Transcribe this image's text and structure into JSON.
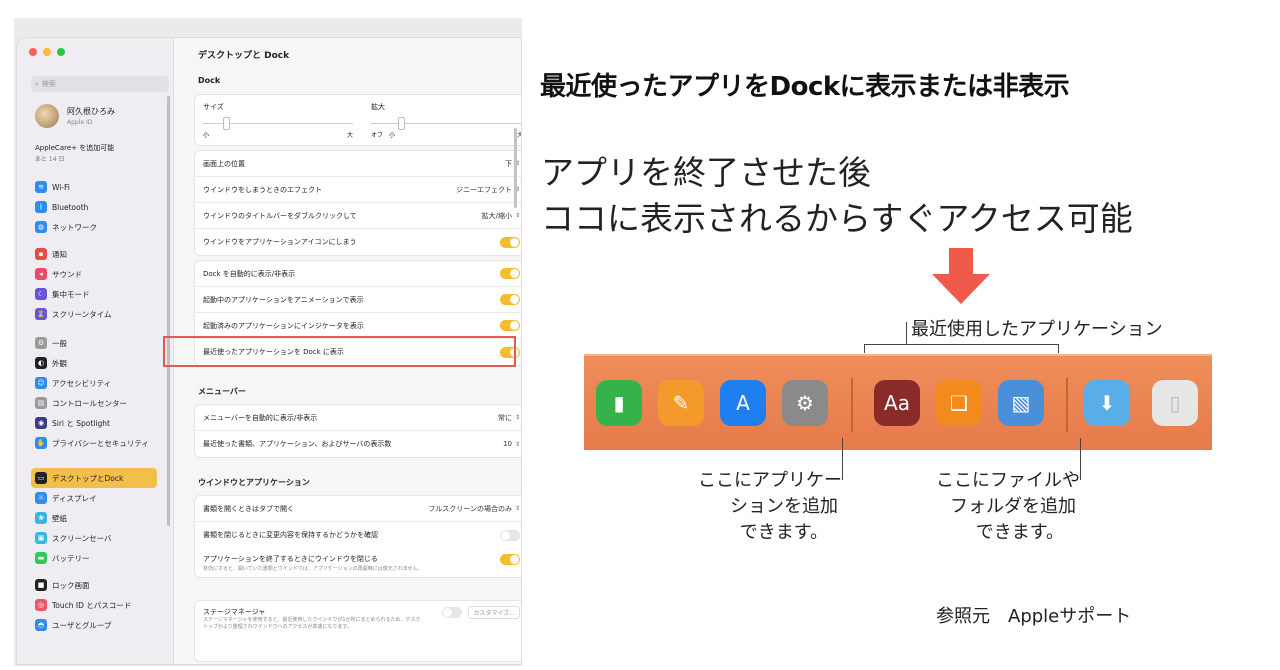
{
  "sidebar": {
    "search_placeholder": "検索",
    "account_name": "阿久根ひろみ",
    "account_sub": "Apple ID",
    "applecare_title": "AppleCare+ を追加可能",
    "applecare_sub": "あと 14 日",
    "groups": [
      [
        {
          "label": "Wi-Fi",
          "icon": "wifi-icon",
          "color": "#2d8cf0"
        },
        {
          "label": "Bluetooth",
          "icon": "bluetooth-icon",
          "color": "#2d8cf0"
        },
        {
          "label": "ネットワーク",
          "icon": "globe-icon",
          "color": "#2d8cf0"
        }
      ],
      [
        {
          "label": "通知",
          "icon": "bell-icon",
          "color": "#e84a4a"
        },
        {
          "label": "サウンド",
          "icon": "speaker-icon",
          "color": "#e84a67"
        },
        {
          "label": "集中モード",
          "icon": "moon-icon",
          "color": "#6a53d8"
        },
        {
          "label": "スクリーンタイム",
          "icon": "hourglass-icon",
          "color": "#6a53d8"
        }
      ],
      [
        {
          "label": "一般",
          "icon": "gear-icon",
          "color": "#9a9a9a"
        },
        {
          "label": "外観",
          "icon": "appearance-icon",
          "color": "#222222"
        },
        {
          "label": "アクセシビリティ",
          "icon": "accessibility-icon",
          "color": "#2d8cf0"
        },
        {
          "label": "コントロールセンター",
          "icon": "control-center-icon",
          "color": "#9a9a9a"
        },
        {
          "label": "Siri と Spotlight",
          "icon": "siri-icon",
          "color": "#3a3a8a"
        },
        {
          "label": "プライバシーとセキュリティ",
          "icon": "hand-icon",
          "color": "#2d8cf0"
        }
      ],
      [
        {
          "label": "デスクトップとDock",
          "icon": "dock-icon",
          "color": "#222222",
          "active": true
        },
        {
          "label": "ディスプレイ",
          "icon": "sun-icon",
          "color": "#2d8cf0"
        },
        {
          "label": "壁紙",
          "icon": "wallpaper-icon",
          "color": "#38b6e8"
        },
        {
          "label": "スクリーンセーバ",
          "icon": "screensaver-icon",
          "color": "#38b6e8"
        },
        {
          "label": "バッテリー",
          "icon": "battery-icon",
          "color": "#33c759"
        }
      ],
      [
        {
          "label": "ロック画面",
          "icon": "lock-icon",
          "color": "#222222"
        },
        {
          "label": "Touch ID とパスコード",
          "icon": "fingerprint-icon",
          "color": "#e85a6a"
        },
        {
          "label": "ユーザとグループ",
          "icon": "users-icon",
          "color": "#2d8cf0"
        }
      ]
    ]
  },
  "content": {
    "title": "デスクトップと Dock",
    "dock_section": "Dock",
    "size_label": "サイズ",
    "size_min": "小",
    "size_max": "大",
    "size_value": 0.15,
    "magnify_label": "拡大",
    "magnify_off": "オフ",
    "magnify_min": "小",
    "magnify_max": "大",
    "magnify_value": 0.2,
    "rows_a": [
      {
        "label": "画面上の位置",
        "value": "下",
        "kind": "select"
      },
      {
        "label": "ウインドウをしまうときのエフェクト",
        "value": "ジニーエフェクト",
        "kind": "select"
      },
      {
        "label": "ウインドウのタイトルバーをダブルクリックして",
        "value": "拡大/縮小",
        "kind": "select"
      },
      {
        "label": "ウインドウをアプリケーションアイコンにしまう",
        "value": "",
        "kind": "toggle",
        "on": true
      }
    ],
    "rows_b": [
      {
        "label": "Dock を自動的に表示/非表示",
        "value": "",
        "kind": "toggle",
        "on": true
      },
      {
        "label": "起動中のアプリケーションをアニメーションで表示",
        "value": "",
        "kind": "toggle",
        "on": true
      },
      {
        "label": "起動済みのアプリケーションにインジケータを表示",
        "value": "",
        "kind": "toggle",
        "on": true
      },
      {
        "label": "最近使ったアプリケーションを Dock に表示",
        "value": "",
        "kind": "toggle",
        "on": true
      }
    ],
    "menubar_section": "メニューバー",
    "rows_c": [
      {
        "label": "メニューバーを自動的に表示/非表示",
        "value": "常に",
        "kind": "select"
      },
      {
        "label": "最近使った書類、アプリケーション、およびサーバの表示数",
        "value": "10",
        "kind": "select"
      }
    ],
    "windows_section": "ウインドウとアプリケーション",
    "rows_d": [
      {
        "label": "書類を開くときはタブで開く",
        "value": "フルスクリーンの場合のみ",
        "kind": "select"
      },
      {
        "label": "書類を閉じるときに変更内容を保持するかどうかを確認",
        "value": "",
        "kind": "toggle",
        "on": false
      }
    ],
    "close_windows_label": "アプリケーションを終了するときにウインドウを閉じる",
    "close_windows_note": "有効にすると、開いていた書類とウインドウは、アプリケーションの再開時には復元されません。",
    "stage_label": "ステージマネージャ",
    "stage_note": "ステージマネージャを使用すると、最近使用したウインドウが1か所にまとめられるため、デスクトップがより整理されウインドウへのアクセスが高速になります。",
    "stage_button": "カスタマイズ..."
  },
  "annotation": {
    "headline": "最近使ったアプリをDockに表示または非表示",
    "note_line1": "アプリを終了させた後",
    "note_line2": "ココに表示されるからすぐアクセス可能",
    "recent_label": "最近使用したアプリケーション",
    "apps_hint_line1": "ここにアプリケー",
    "apps_hint_line2": "ションを追加",
    "apps_hint_line3": "できます。",
    "files_hint_line1": "ここにファイルや",
    "files_hint_line2": "フォルダを追加",
    "files_hint_line3": "できます。",
    "source": "参照元　Appleサポート",
    "arrow_color": "#f05a4b"
  },
  "dock_apps": [
    {
      "name": "numbers-icon",
      "color": "#35b34a"
    },
    {
      "name": "pages-icon",
      "color": "#f39a2a"
    },
    {
      "name": "app-store-icon",
      "color": "#1e7ff0"
    },
    {
      "name": "system-settings-icon",
      "color": "#8a8a8a"
    },
    {
      "name": "dictionary-icon",
      "color": "#8b2a2a"
    },
    {
      "name": "books-icon",
      "color": "#f28a1e"
    },
    {
      "name": "preview-icon",
      "color": "#4a90d9"
    },
    {
      "name": "downloads-folder-icon",
      "color": "#5aaee8"
    },
    {
      "name": "trash-icon",
      "color": "#e6e6e6"
    }
  ]
}
